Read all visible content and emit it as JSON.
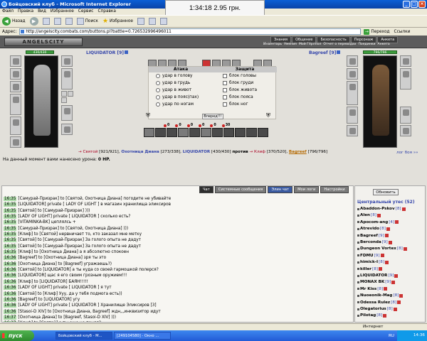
{
  "window": {
    "title": "Бойцовский клуб - Microsoft Internet Explorer",
    "overlay_text": "1:34:18  2.95 грн."
  },
  "menu": [
    "Файл",
    "Правка",
    "Вид",
    "Избранное",
    "Сервис",
    "Справка"
  ],
  "toolbar": {
    "back": "Назад",
    "search": "Поиск",
    "favorites": "Избранное"
  },
  "address": {
    "label": "Адрес:",
    "url": "http://angelscity.combats.com/buttons.pl?battle=0.726532996496011",
    "go": "Переход",
    "links": "Ссылки"
  },
  "game": {
    "logo": "ANGELSCITY",
    "topnav": [
      "Знания",
      "Общение",
      "Безопасность",
      "Персонаж",
      "Анкета"
    ],
    "subnav": [
      "Инвентарь",
      "Умения",
      "Мой Гёрлпол",
      "Отчет о переводах",
      "Поединки",
      "Анкета"
    ],
    "left_player": {
      "name": "LIQUIDATOR",
      "level": "[9]",
      "hp": "430/430",
      "hp_frac": 1.0
    },
    "right_player": {
      "name": "Bagreef",
      "level": "[9]",
      "hp": "796/796",
      "hp_frac": 1.0
    },
    "attack": {
      "header": "Атака",
      "options": [
        "удар в голову",
        "удар в грудь",
        "удар в живот",
        "удар в пояс(пах)",
        "удар по ногам"
      ]
    },
    "defense": {
      "header": "Защита",
      "options": [
        "блок головы",
        "блок груди",
        "блок живота",
        "блок пояса",
        "блок ног"
      ]
    },
    "forward_button": "Вперед!!!",
    "counters": [
      "0",
      "0",
      "0",
      "0",
      "0",
      "30"
    ],
    "vs": {
      "team1_a": "Святой",
      "team1_a_hp": "[921/921]",
      "team1_b": "Охотница Диана",
      "team1_b_hp": "[273/338]",
      "team1_c": "LIQUIDATOR",
      "team1_c_hp": "[430/430]",
      "word": "против",
      "team2_a": "Клиф",
      "team2_a_hp": "[370/520]",
      "team2_b": "Bagreef",
      "team2_b_hp": "[796/796]"
    },
    "log_link": "лог боя »»",
    "damage_text": "На данный момент вами нанесено урона:",
    "damage_value": "0 HP."
  },
  "chat": {
    "tabs": [
      "Чат",
      "Системные сообщения",
      "Элин чат",
      "Мои логи",
      "Настройки"
    ],
    "lines": [
      {
        "time": "16:35",
        "text": "[Самурай-Призрак] to [Святой, Охотница Диана] погодите не убивайте"
      },
      {
        "time": "16:35",
        "text": "[LIQUIDATOR] private [ LADY OF LIGHT ] в магазин хранилища эликсиров"
      },
      {
        "time": "16:35",
        "text": "[Святой] to [Самурай-Призрак] )))"
      },
      {
        "time": "16:35",
        "text": "[LADY OF LIGHT] private [ LIQUIDATOR ] сколько есть?"
      },
      {
        "time": "16:35",
        "text": "[VITAMINKA-BK] цеплялсь +"
      },
      {
        "time": "16:35",
        "text": "[Самурай-Призрак] to [Святой, Охотница Диана] )))"
      },
      {
        "time": "16:35",
        "text": "[Клиф] to [Святой] нервничает то, кто заказал мне метку"
      },
      {
        "time": "16:35",
        "text": "[Святой] to [Самурай-Призрак] За голого опыта не дадут"
      },
      {
        "time": "16:35",
        "text": "[Святой] to [Самурай-Призрак] За голого опыта не дадут"
      },
      {
        "time": "16:35",
        "text": "[Клиф] to [Охотница Диана] а я абсолютно спокоен"
      },
      {
        "time": "16:36",
        "text": "[Bagreef] to [Охотница Диана] зря ты это"
      },
      {
        "time": "16:36",
        "text": "[Охотница Диана] to [Bagreef] угражаешь?)"
      },
      {
        "time": "16:36",
        "text": "[Святой] to [LIQUIDATOR] а ты куда со своей гармошкой полерся?"
      },
      {
        "time": "16:36",
        "text": "[LIQUIDATOR] щас я его своим грозным оружием!!!"
      },
      {
        "time": "16:36",
        "text": "[Клиф] to [LIQUIDATOR] БАЯН!!!!!"
      },
      {
        "time": "16:36",
        "text": "[LADY OF LIGHT] private [ LIQUIDATOR ] я тут"
      },
      {
        "time": "16:36",
        "text": "[Святой] to [Клиф] Ууу, да у тебя подмога есть))"
      },
      {
        "time": "16:36",
        "text": "[Bagreef] to [LIQUIDATOR] угу"
      },
      {
        "time": "16:36",
        "text": "[LADY OF LIGHT] private [ LIQUIDATOR ] Хранилище Эликсиров [3]"
      },
      {
        "time": "16:36",
        "text": "[Stasoi-D XIV] to [Охотница Диана, Bagreef] ждн,,,инквизитор идут"
      },
      {
        "time": "16:37",
        "text": "[Охотница Диана] to [Bagreef, Stasoi-D XIV] )))"
      },
      {
        "time": "16:37",
        "text": "[Клиф] to [Святой] а ты еще не понял?"
      }
    ]
  },
  "sidebar": {
    "refresh": "Обновить",
    "room": "Центральный утес (52)",
    "users": [
      {
        "name": "Abaddon-Pskov",
        "level": "[8]"
      },
      {
        "name": "Alen",
        "level": "[8]"
      },
      {
        "name": "Apocom-ang",
        "level": "[4]"
      },
      {
        "name": "Atrevido",
        "level": "[8]"
      },
      {
        "name": "Bagreef",
        "level": "[9]"
      },
      {
        "name": "Berconda",
        "level": "[9]"
      },
      {
        "name": "Dungeon Vortex",
        "level": "[8]"
      },
      {
        "name": "FDMU",
        "level": "[9]"
      },
      {
        "name": "himick-I",
        "level": "[8]"
      },
      {
        "name": "killer",
        "level": "[8]"
      },
      {
        "name": "LIQUIDATOR",
        "level": "[9]"
      },
      {
        "name": "MONAX BK",
        "level": "[9]"
      },
      {
        "name": "Mr Kiss",
        "level": "[8]"
      },
      {
        "name": "Nuoeonik-Mag",
        "level": "[8]"
      },
      {
        "name": "Odessa Rulez",
        "level": "[8]"
      },
      {
        "name": "Olegatorius",
        "level": "[8]"
      },
      {
        "name": "Pilotag",
        "level": "[8]"
      }
    ]
  },
  "status": {
    "left": "",
    "right": "Интернет"
  },
  "taskbar": {
    "start": "пуск",
    "tasks": [
      "Бойцовский клуб - M...",
      "[249104580] - Окно ..."
    ],
    "lang": "RU",
    "time": "14:36"
  }
}
